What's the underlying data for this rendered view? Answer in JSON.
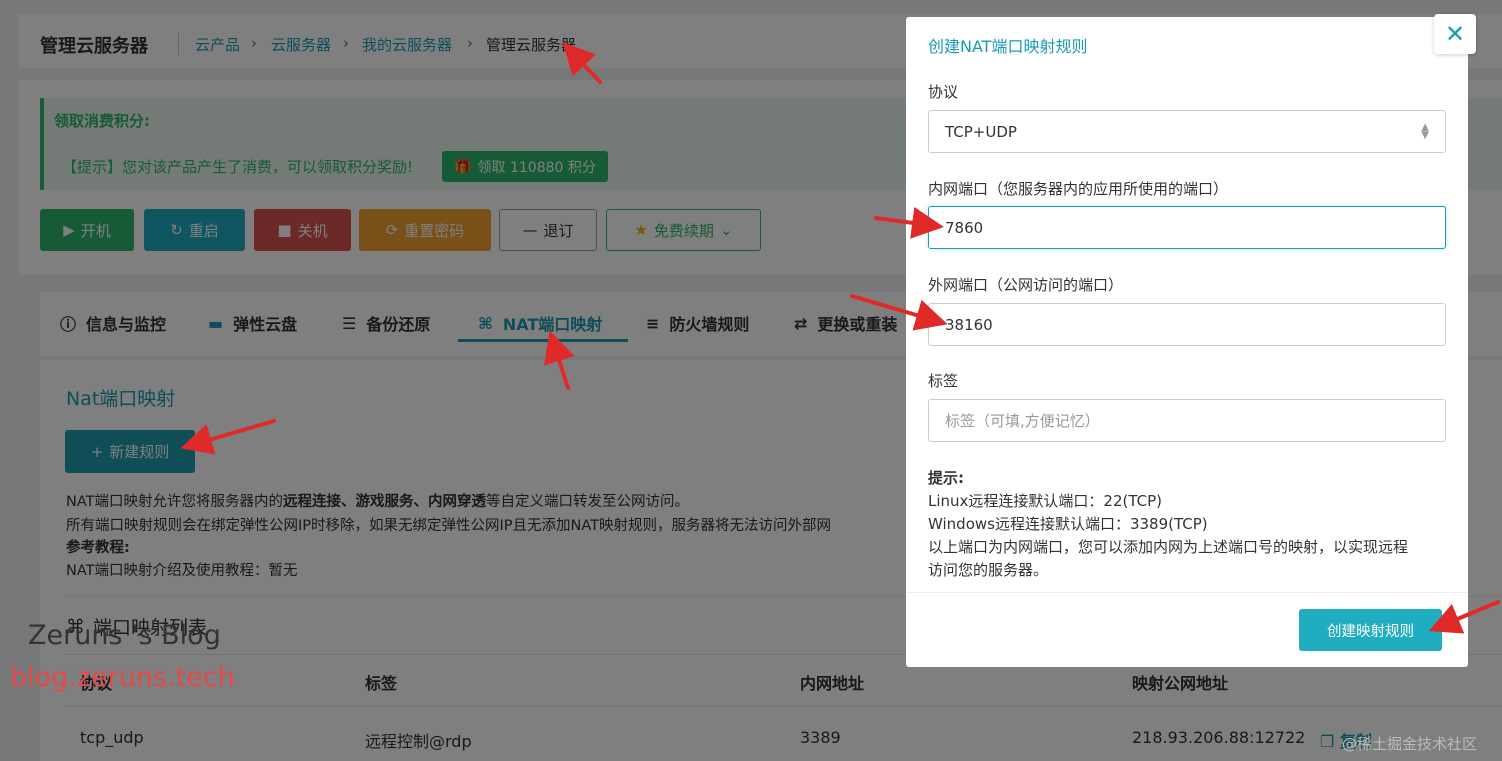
{
  "header": {
    "title": "管理云服务器",
    "breadcrumb": [
      "云产品",
      "云服务器",
      "我的云服务器",
      "管理云服务器"
    ]
  },
  "notice": {
    "title": "领取消费积分:",
    "text": "【提示】您对该产品产生了消费，可以领取积分奖励!",
    "button": "领取 110880 积分"
  },
  "actions": {
    "start": "开机",
    "restart": "重启",
    "shutdown": "关机",
    "reset_password": "重置密码",
    "unsubscribe": "退订",
    "renew": "免费续期"
  },
  "tabs": [
    "信息与监控",
    "弹性云盘",
    "备份还原",
    "NAT端口映射",
    "防火墙规则",
    "更换或重装"
  ],
  "nat": {
    "title": "Nat端口映射",
    "new_rule": "新建规则",
    "desc_line1_a": "NAT端口映射允许您将服务器内的",
    "desc_line1_b": "远程连接、游戏服务、内网穿透",
    "desc_line1_c": "等自定义端口转发至公网访问。",
    "desc_line2": "所有端口映射规则会在绑定弹性公网IP时移除，如果无绑定弹性公网IP且无添加NAT映射规则，服务器将无法访问外部网",
    "ref_title": "参考教程:",
    "ref_text": "NAT端口映射介绍及使用教程：暂无",
    "list_title": "端口映射列表"
  },
  "table": {
    "headers": [
      "协议",
      "标签",
      "内网地址",
      "映射公网地址"
    ],
    "rows": [
      {
        "protocol": "tcp_udp",
        "label": "远程控制@rdp",
        "internal": "3389",
        "public": "218.93.206.88:12722",
        "copy": "复制"
      }
    ]
  },
  "modal": {
    "title": "创建NAT端口映射规则",
    "protocol_label": "协议",
    "protocol_value": "TCP+UDP",
    "internal_port_label": "内网端口（您服务器内的应用所使用的端口）",
    "internal_port_value": "7860",
    "external_port_label": "外网端口（公网访问的端口）",
    "external_port_value": "38160",
    "tag_label": "标签",
    "tag_placeholder": "标签（可填,方便记忆）",
    "hint_title": "提示:",
    "hint_lines": [
      "Linux远程连接默认端口：22(TCP)",
      "Windows远程连接默认端口：3389(TCP)",
      "以上端口为内网端口，您可以添加内网为上述端口号的映射，以实现远程",
      "访问您的服务器。"
    ],
    "submit": "创建映射规则"
  },
  "watermark": {
    "line1": "Zeruns 's Blog",
    "line2": "blog.zeruns.tech",
    "line3": "@稀土掘金技术社区"
  },
  "colors": {
    "accent": "#1a9bb4",
    "green": "#2db76a",
    "teal": "#20a8c6",
    "red": "#d9534f",
    "orange": "#f0a030",
    "arrow": "#e02a2a"
  }
}
